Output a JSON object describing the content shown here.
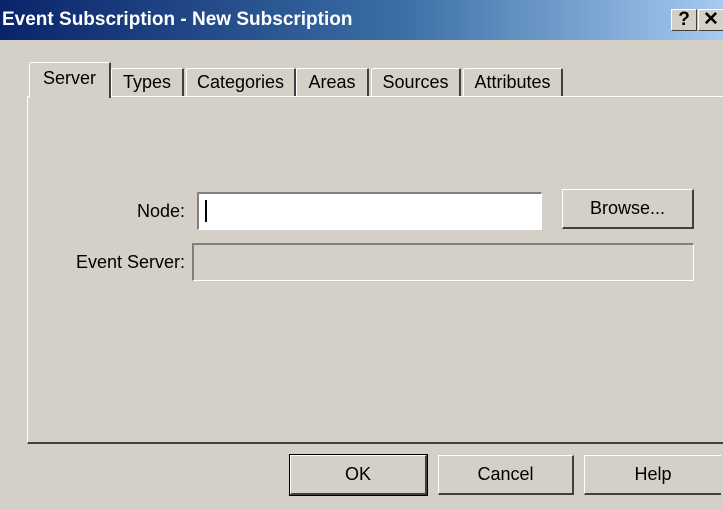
{
  "window": {
    "title": "Event Subscription - New Subscription",
    "help_button": "?",
    "close_button": "✕"
  },
  "tabs": [
    {
      "label": "Server",
      "active": true
    },
    {
      "label": "Types",
      "active": false
    },
    {
      "label": "Categories",
      "active": false
    },
    {
      "label": "Areas",
      "active": false
    },
    {
      "label": "Sources",
      "active": false
    },
    {
      "label": "Attributes",
      "active": false
    }
  ],
  "server_tab": {
    "node_label": "Node:",
    "node_value": "",
    "browse_label": "Browse...",
    "event_server_label": "Event Server:",
    "event_server_value": ""
  },
  "buttons": {
    "ok": "OK",
    "cancel": "Cancel",
    "help": "Help"
  },
  "colors": {
    "title_gradient_start": "#0a246a",
    "title_gradient_end": "#a6caf0",
    "dialog_face": "#d4d0c8"
  }
}
